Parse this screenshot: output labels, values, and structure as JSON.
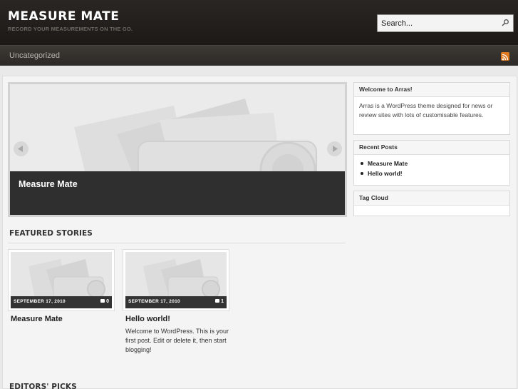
{
  "header": {
    "site_title": "MEASURE MATE",
    "tagline": "RECORD YOUR MEASUREMENTS ON THE GO.",
    "search_placeholder": "Search..."
  },
  "nav": {
    "items": [
      {
        "label": "Uncategorized"
      }
    ],
    "rss_icon": "rss-icon"
  },
  "slideshow": {
    "current_title": "Measure Mate",
    "prev_icon": "arrow-left-icon",
    "next_icon": "arrow-right-icon"
  },
  "featured": {
    "title": "FEATURED STORIES",
    "posts": [
      {
        "date": "SEPTEMBER 17, 2010",
        "comments": "0",
        "title": "Measure Mate",
        "excerpt": ""
      },
      {
        "date": "SEPTEMBER 17, 2010",
        "comments": "1",
        "title": "Hello world!",
        "excerpt": "Welcome to WordPress. This is your first post. Edit or delete it, then start blogging!"
      }
    ]
  },
  "editors_picks": {
    "title": "EDITORS' PICKS"
  },
  "sidebar": {
    "welcome": {
      "title": "Welcome to Arras!",
      "text": "Arras is a WordPress theme designed for news or review sites with lots of customisable features."
    },
    "recent_posts": {
      "title": "Recent Posts",
      "items": [
        "Measure Mate",
        "Hello world!"
      ]
    },
    "tag_cloud": {
      "title": "Tag Cloud"
    }
  },
  "colors": {
    "header_bg": "#1f1b19",
    "nav_bg": "#35312d",
    "rss": "#e07a1f",
    "caption_bg": "#2f2f2f"
  }
}
